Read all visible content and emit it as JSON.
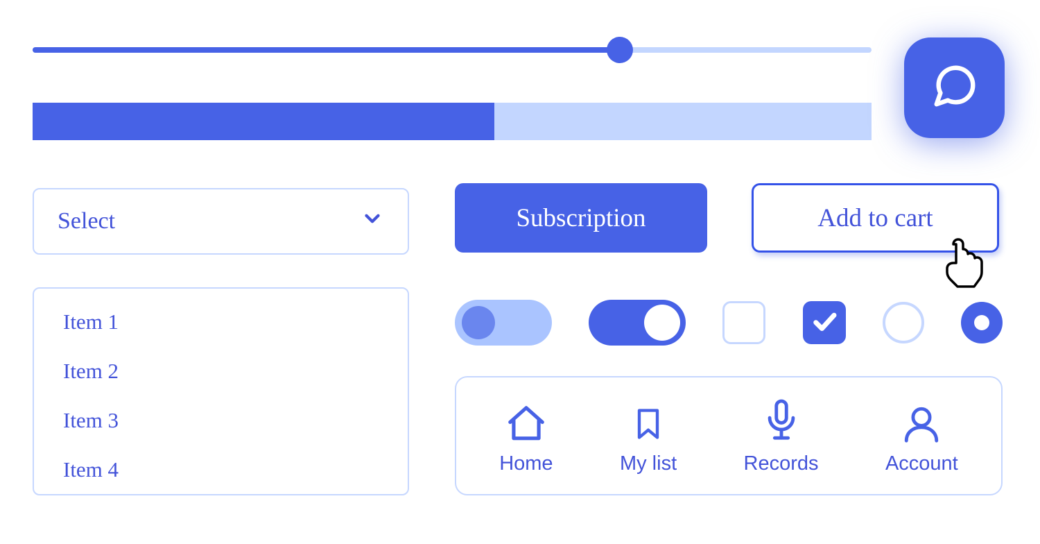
{
  "slider": {
    "value_percent": 70
  },
  "progress": {
    "value_percent": 55
  },
  "select": {
    "label": "Select"
  },
  "list": {
    "items": [
      "Item 1",
      "Item 2",
      "Item 3",
      "Item 4"
    ]
  },
  "buttons": {
    "primary": "Subscription",
    "outline": "Add to cart"
  },
  "controls": {
    "toggle_off": false,
    "toggle_on": true,
    "checkbox_unchecked": false,
    "checkbox_checked": true,
    "radio_unchecked": false,
    "radio_checked": true
  },
  "nav": {
    "items": [
      {
        "icon": "home-icon",
        "label": "Home"
      },
      {
        "icon": "bookmark-icon",
        "label": "My list"
      },
      {
        "icon": "microphone-icon",
        "label": "Records"
      },
      {
        "icon": "user-icon",
        "label": "Account"
      }
    ]
  },
  "colors": {
    "primary": "#4762e6",
    "light": "#c3d6ff"
  }
}
